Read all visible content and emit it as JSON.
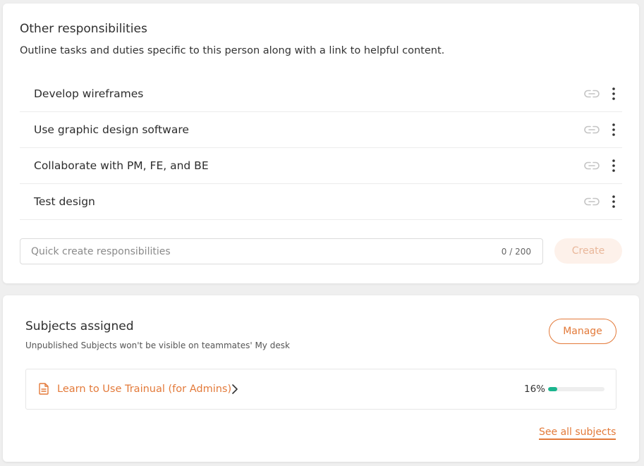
{
  "responsibilities": {
    "title": "Other responsibilities",
    "description": "Outline tasks and duties specific to this person along with a link to helpful content.",
    "items": [
      {
        "label": "Develop wireframes"
      },
      {
        "label": "Use graphic design software"
      },
      {
        "label": "Collaborate with PM, FE, and BE"
      },
      {
        "label": "Test design"
      }
    ],
    "row_icons": [
      "link-icon",
      "more-vertical-icon"
    ],
    "quick_create": {
      "placeholder": "Quick create responsibilities",
      "count": "0 / 200"
    },
    "create_label": "Create"
  },
  "subjects": {
    "title": "Subjects assigned",
    "subtitle": "Unpublished Subjects won't be visible on teammates' My desk",
    "manage_label": "Manage",
    "items": [
      {
        "name": "Learn to Use Trainual (for Admins)",
        "progress_text": "16%",
        "progress": 0.16
      }
    ],
    "see_all_label": "See all subjects"
  },
  "colors": {
    "accent": "#e37a3a",
    "progress": "#1bb58e",
    "create_bg": "#fdf1ea",
    "create_text": "#e9b79a"
  }
}
